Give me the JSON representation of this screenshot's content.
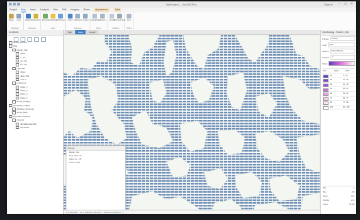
{
  "app": {
    "title": "MyProject — ArcGIS Pro",
    "signin": "Sign in"
  },
  "window_controls": [
    "–",
    "□",
    "×"
  ],
  "ribbon_tabs": [
    {
      "label": "Project",
      "active": false,
      "ctx": false
    },
    {
      "label": "Map",
      "active": true,
      "ctx": false
    },
    {
      "label": "Insert",
      "active": false,
      "ctx": false
    },
    {
      "label": "Analysis",
      "active": false,
      "ctx": false
    },
    {
      "label": "View",
      "active": false,
      "ctx": false
    },
    {
      "label": "Edit",
      "active": false,
      "ctx": false
    },
    {
      "label": "Imagery",
      "active": false,
      "ctx": false
    },
    {
      "label": "Share",
      "active": false,
      "ctx": false
    },
    {
      "label": "Appearance",
      "active": false,
      "ctx": true
    },
    {
      "label": "Data",
      "active": false,
      "ctx": true
    }
  ],
  "ribbon_groups": [
    {
      "name": "Clipboard",
      "tools": [
        {
          "label": "Paste",
          "color": "#c9a54a"
        },
        {
          "label": "Copy",
          "color": "#8aa4c2"
        }
      ]
    },
    {
      "name": "Navigate",
      "tools": [
        {
          "label": "Explore",
          "color": "#3d7bc4"
        },
        {
          "label": "Bookmarks",
          "color": "#d6b13a"
        }
      ]
    },
    {
      "name": "Layer",
      "tools": [
        {
          "label": "Basemap",
          "color": "#74a96a"
        },
        {
          "label": "Add Data",
          "color": "#e6c34a"
        },
        {
          "label": "Add Preset",
          "color": "#6aa0d8"
        }
      ]
    },
    {
      "name": "Selection",
      "tools": [
        {
          "label": "Select",
          "color": "#4c86c9"
        },
        {
          "label": "Attributes",
          "color": "#9cb0c8"
        },
        {
          "label": "Location",
          "color": "#8ca9c0"
        }
      ]
    },
    {
      "name": "Inquiry",
      "tools": [
        {
          "label": "Infographics",
          "color": "#b5c2cf"
        },
        {
          "label": "Measure",
          "color": "#a7b8c9"
        }
      ]
    },
    {
      "name": "Labeling",
      "tools": [
        {
          "label": "Convert",
          "color": "#c1ccd6"
        },
        {
          "label": "Download Map",
          "color": "#98a8b8"
        }
      ]
    },
    {
      "name": "Offline",
      "tools": [
        {
          "label": "Sync",
          "color": "#a9b7c4"
        }
      ]
    }
  ],
  "contents": {
    "title": "Contents",
    "search_placeholder": "Search",
    "items": [
      "Drawing Order",
      "Map",
      "  Raster_Clip",
      "    Value",
      "    0 - 12",
      "    12 - 25",
      "    25 - 38",
      "  Hillshade",
      "    Value",
      "    High: 254",
      "    Low: 0",
      "  Landcover",
      "    Class_1",
      "    Class_2",
      "    Class_3",
      "    Class_4",
      "  World_Imagery",
      "Standalone Tables",
      "  Attribute_Summary",
      "  Zonal_Stats",
      "Elevation Surfaces",
      "  Ground",
      "    WorldElevation3D",
      "    Terrain3D"
    ]
  },
  "map": {
    "tabs": [
      {
        "label": "Map",
        "on": false
      },
      {
        "label": "Map1",
        "on": true
      },
      {
        "label": "Layout",
        "on": false
      }
    ],
    "status": "1:2,500,000   ⌄   ⊞   ⟲   128.45°E 52.30°N   ⌄   Selected Features: 0",
    "water_color": "#6e8fb2",
    "land_color": "#f4f6f1"
  },
  "attribute_popup": {
    "title": "Pop-up",
    "rows": [
      "Raster_Clip",
      "Pixel value: 18",
      "Class: 12 - 25",
      "Count: 4,512"
    ]
  },
  "symbology": {
    "title": "Symbology - Raster_Clip",
    "fields": [
      {
        "label": "Primary",
        "value": "Classify"
      },
      {
        "label": "Field",
        "value": "Value"
      },
      {
        "label": "Method",
        "value": "Natural Breaks"
      },
      {
        "label": "Classes",
        "value": "5"
      },
      {
        "label": "Ramp",
        "value": ""
      }
    ],
    "table_head": [
      "Sym",
      "Upper",
      "Label"
    ],
    "classes": [
      {
        "color": "#5a3fbf",
        "upper": "12",
        "label": "0 - 12"
      },
      {
        "color": "#7a4cc9",
        "upper": "25",
        "label": "12 - 25"
      },
      {
        "color": "#9f5ad1",
        "upper": "38",
        "label": "25 - 38"
      },
      {
        "color": "#c872d9",
        "upper": "51",
        "label": "38 - 51"
      },
      {
        "color": "#e8a6e4",
        "upper": "64",
        "label": "51 - 64"
      },
      {
        "color": "#f4cdee",
        "upper": "77",
        "label": "64 - 77"
      },
      {
        "color": "#fae4f5",
        "upper": "90",
        "label": "77 - 90"
      },
      {
        "color": "#ffffff",
        "upper": "103",
        "label": "90 - 103"
      }
    ],
    "histogram": [
      {
        "label": "Min",
        "value": "0"
      },
      {
        "label": "Max",
        "value": "103"
      },
      {
        "label": "Mean",
        "value": "36.2"
      },
      {
        "label": "Std Dev",
        "value": "21.8"
      },
      {
        "label": "Count",
        "value": "52,406"
      }
    ]
  }
}
